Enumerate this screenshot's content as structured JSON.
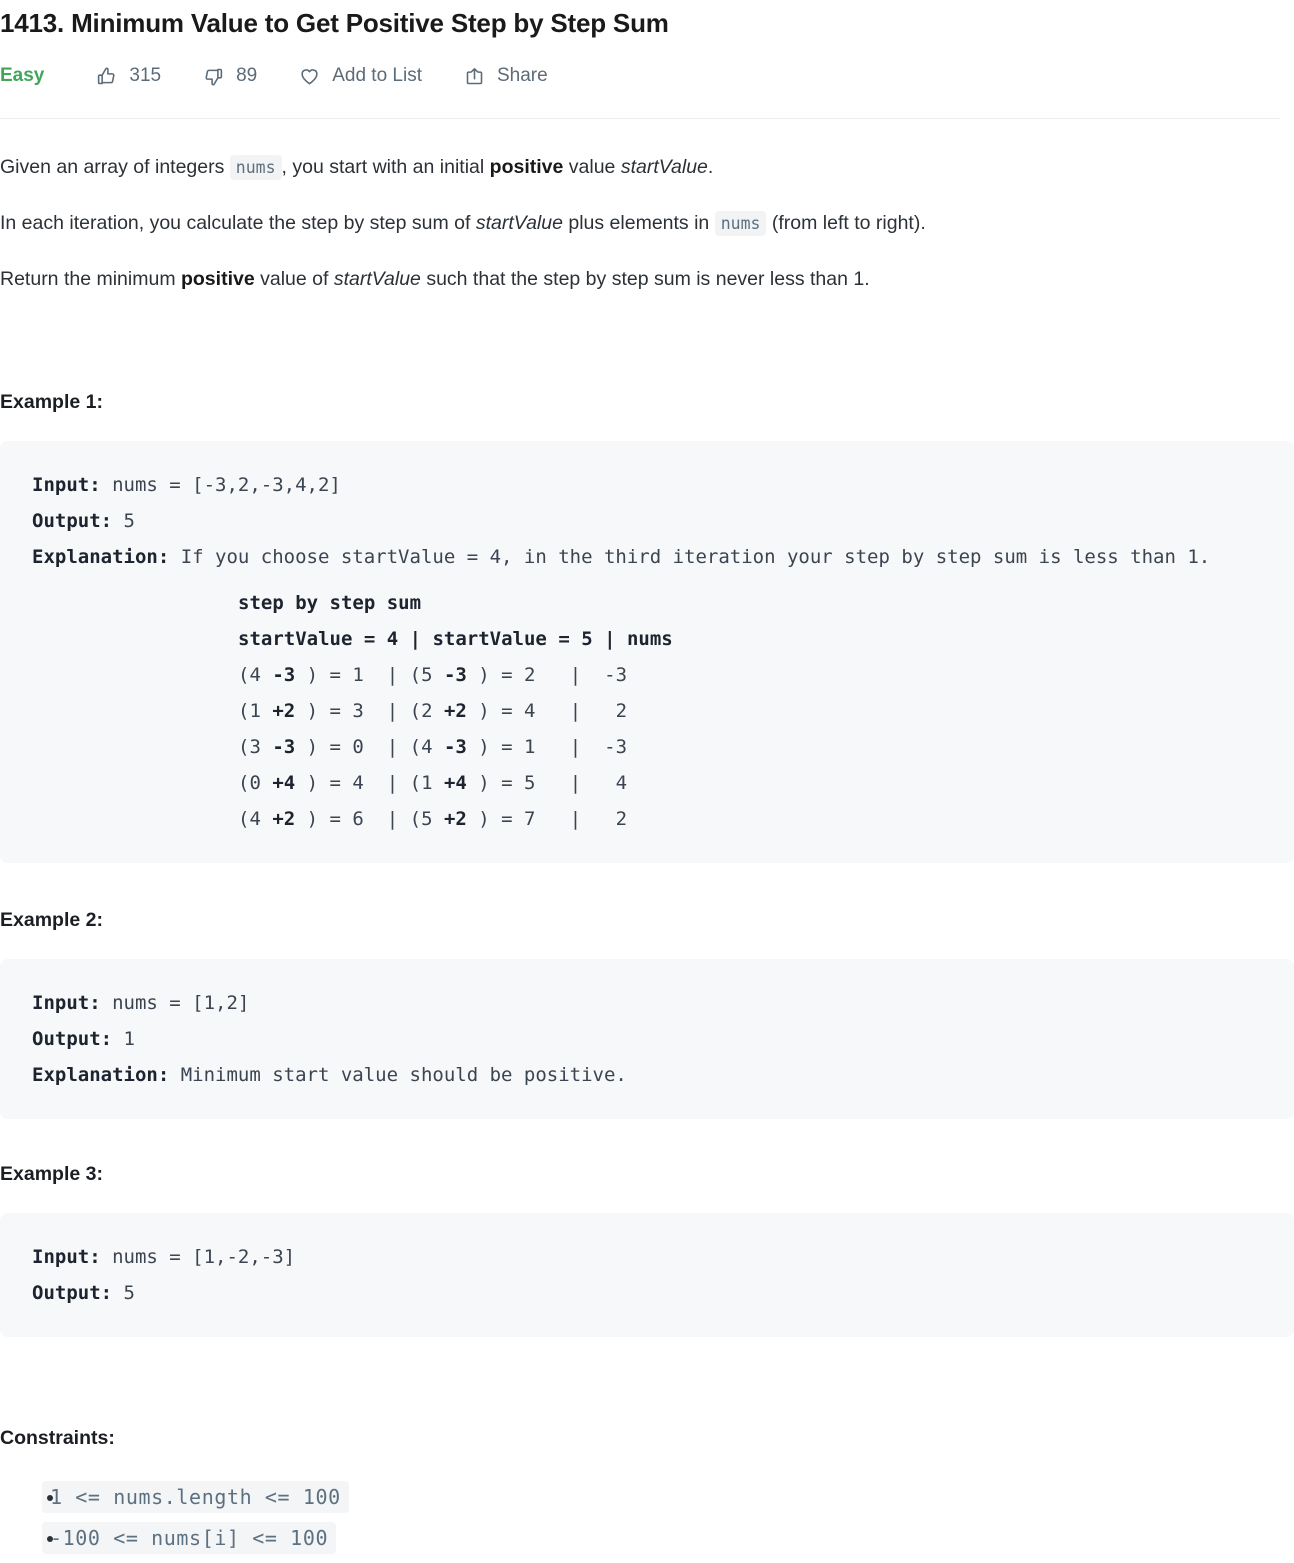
{
  "header": {
    "title": "1413. Minimum Value to Get Positive Step by Step Sum",
    "difficulty": "Easy",
    "likes": "315",
    "dislikes": "89",
    "add_to_list": "Add to List",
    "share": "Share",
    "accent_green": "#3fa75a",
    "muted": "#5c6b78"
  },
  "description": {
    "p1_a": "Given an array of integers",
    "p1_code": "nums",
    "p1_b": ", you start with an initial",
    "p1_bold": "positive",
    "p1_c": "value",
    "p1_italic": "startValue",
    "p1_d": ".",
    "p2_a": "In each iteration, you calculate the step by step sum of",
    "p2_italic": "startValue",
    "p2_b": "plus elements in",
    "p2_code": "nums",
    "p2_c": "(from left to right).",
    "p3_a": "Return the minimum",
    "p3_bold": "positive",
    "p3_b": "value of",
    "p3_italic": "startValue",
    "p3_c": "such that the step by step sum is never less than 1."
  },
  "examples": [
    {
      "heading": "Example 1:",
      "input_label": "Input:",
      "input_value": " nums = [-3,2,-3,4,2]",
      "output_label": "Output:",
      "output_value": " 5",
      "explanation_label": "Explanation:",
      "explanation_value": " If you choose startValue = 4, in the third iteration your step by step sum is less than 1.",
      "table": {
        "caption": "step by step sum",
        "header_col1": "startValue = 4",
        "header_sep1": " | ",
        "header_col2": "startValue = 5",
        "header_sep2": " | ",
        "header_col3": "nums",
        "rows": [
          {
            "c1_pre": "(4 ",
            "c1_delta": "-3",
            "c1_post": " ) = 1",
            "sep1": "  | ",
            "c2_pre": "(5 ",
            "c2_delta": "-3",
            "c2_post": " ) = 2",
            "sep2": "   |  ",
            "c3": "-3"
          },
          {
            "c1_pre": "(1 ",
            "c1_delta": "+2",
            "c1_post": " ) = 3",
            "sep1": "  | ",
            "c2_pre": "(2 ",
            "c2_delta": "+2",
            "c2_post": " ) = 4",
            "sep2": "   |   ",
            "c3": "2"
          },
          {
            "c1_pre": "(3 ",
            "c1_delta": "-3",
            "c1_post": " ) = 0",
            "sep1": "  | ",
            "c2_pre": "(4 ",
            "c2_delta": "-3",
            "c2_post": " ) = 1",
            "sep2": "   |  ",
            "c3": "-3"
          },
          {
            "c1_pre": "(0 ",
            "c1_delta": "+4",
            "c1_post": " ) = 4",
            "sep1": "  | ",
            "c2_pre": "(1 ",
            "c2_delta": "+4",
            "c2_post": " ) = 5",
            "sep2": "   |   ",
            "c3": "4"
          },
          {
            "c1_pre": "(4 ",
            "c1_delta": "+2",
            "c1_post": " ) = 6",
            "sep1": "  | ",
            "c2_pre": "(5 ",
            "c2_delta": "+2",
            "c2_post": " ) = 7",
            "sep2": "   |   ",
            "c3": "2"
          }
        ]
      }
    },
    {
      "heading": "Example 2:",
      "input_label": "Input:",
      "input_value": " nums = [1,2]",
      "output_label": "Output:",
      "output_value": " 1",
      "explanation_label": "Explanation:",
      "explanation_value": " Minimum start value should be positive."
    },
    {
      "heading": "Example 3:",
      "input_label": "Input:",
      "input_value": " nums = [1,-2,-3]",
      "output_label": "Output:",
      "output_value": " 5"
    }
  ],
  "constraints": {
    "heading": "Constraints:",
    "items": [
      "1 <= nums.length <= 100",
      "-100 <= nums[i] <= 100"
    ]
  }
}
